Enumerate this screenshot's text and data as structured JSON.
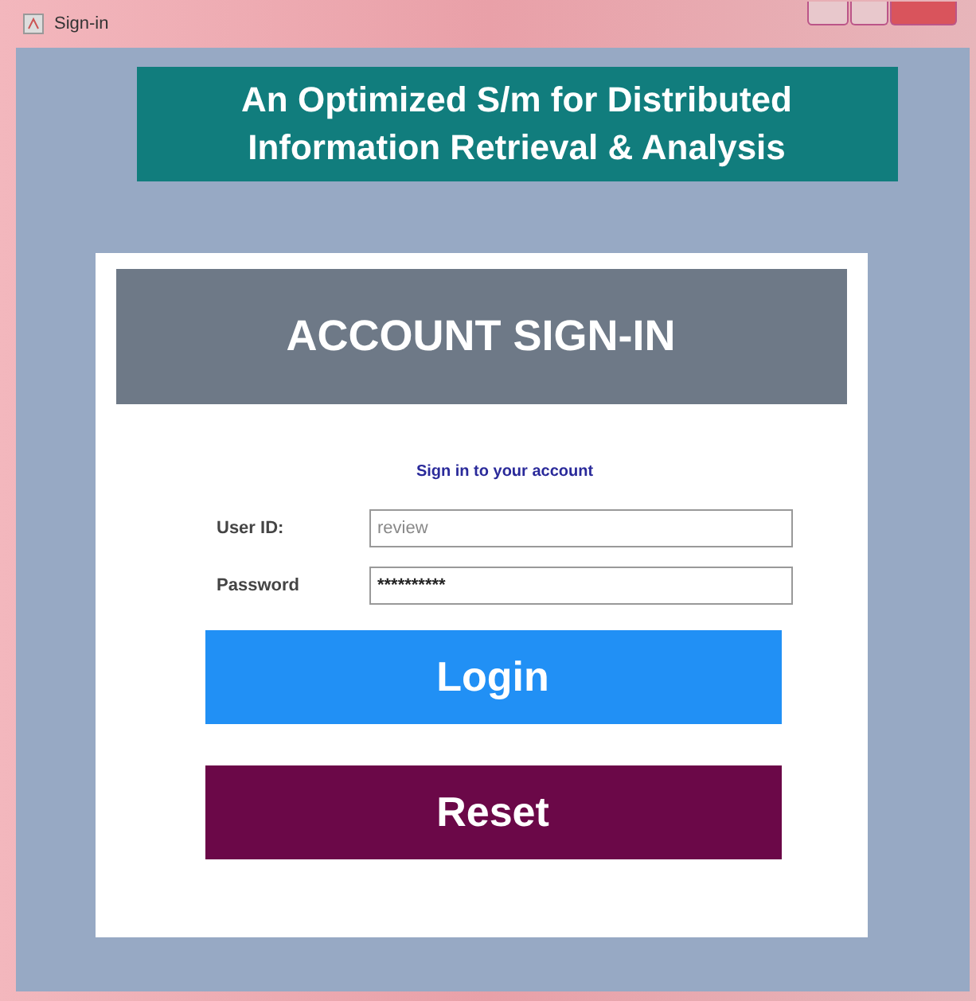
{
  "window": {
    "title": "Sign-in"
  },
  "banner": {
    "lines": [
      "An Optimized S/m for Distributed",
      "Information Retrieval & Analysis"
    ]
  },
  "card": {
    "heading": "ACCOUNT SIGN-IN",
    "subtitle": "Sign in to your account",
    "fields": [
      {
        "label": "User ID:",
        "value": "review"
      },
      {
        "label": "Password",
        "value": "**********"
      }
    ],
    "buttons": [
      {
        "label": "Login",
        "color": "#2190f5"
      },
      {
        "label": "Reset",
        "color": "#6b0848"
      }
    ]
  }
}
